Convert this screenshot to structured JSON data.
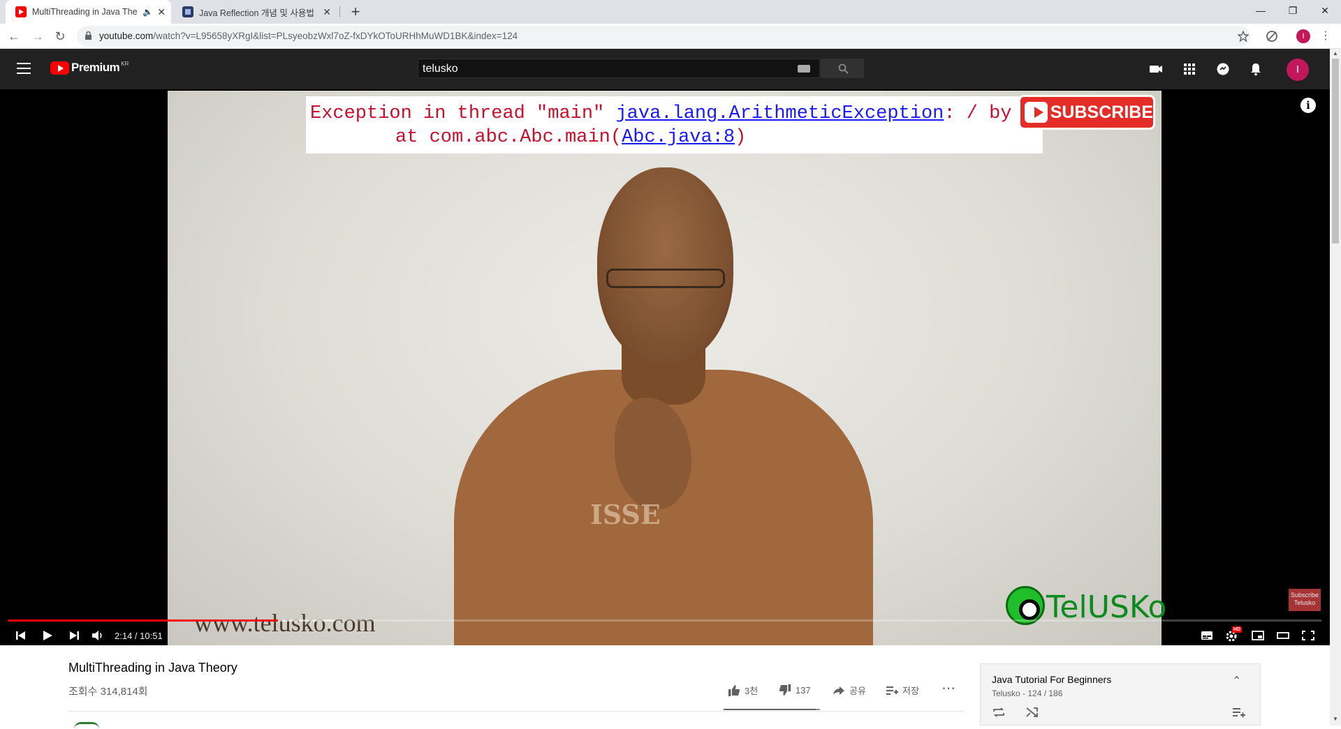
{
  "browser": {
    "tabs": [
      {
        "title": "MultiThreading in Java Theo",
        "active": true
      },
      {
        "title": "Java Reflection 개념 및 사용법",
        "active": false
      }
    ],
    "url_host": "youtube.com",
    "url_path": "/watch?v=L95658yXRgI&list=PLsyeobzWxl7oZ-fxDYkOToURHhMuWD1BK&index=124",
    "profile_initial": "I"
  },
  "youtube": {
    "logo_text": "Premium",
    "logo_region": "KR",
    "search_value": "telusko",
    "avatar_initial": "I"
  },
  "player": {
    "code_line1_prefix": "Exception in thread \"main\" ",
    "code_line1_link": "java.lang.ArithmeticException",
    "code_line1_suffix": ": / by zer",
    "code_line2_prefix": "at com.abc.Abc.main(",
    "code_line2_link": "Abc.java:8",
    "code_line2_suffix": ")",
    "subscribe_label": "SUBSCRIBE",
    "watermark_url": "www.telusko.com",
    "channel_logo_text": "TelUSKo",
    "shirt_text": "ISSE",
    "branding_watermark": "Subscribe Telusko",
    "time_display": "2:14 / 10:51",
    "played_fraction": 0.2055,
    "buffered_fraction": 0.248,
    "hd_badge": "HD"
  },
  "video": {
    "title": "MultiThreading in Java Theory",
    "views": "조회수 314,814회",
    "likes": "3천",
    "dislikes": "137",
    "share_label": "공유",
    "save_label": "저장",
    "like_ratio": 0.958
  },
  "playlist": {
    "title": "Java Tutorial For Beginners",
    "meta": "Telusko - 124 / 186"
  },
  "colors": {
    "accent_red": "#ff0000",
    "header_dark": "#212121",
    "avatar_pink": "#c2185b"
  }
}
